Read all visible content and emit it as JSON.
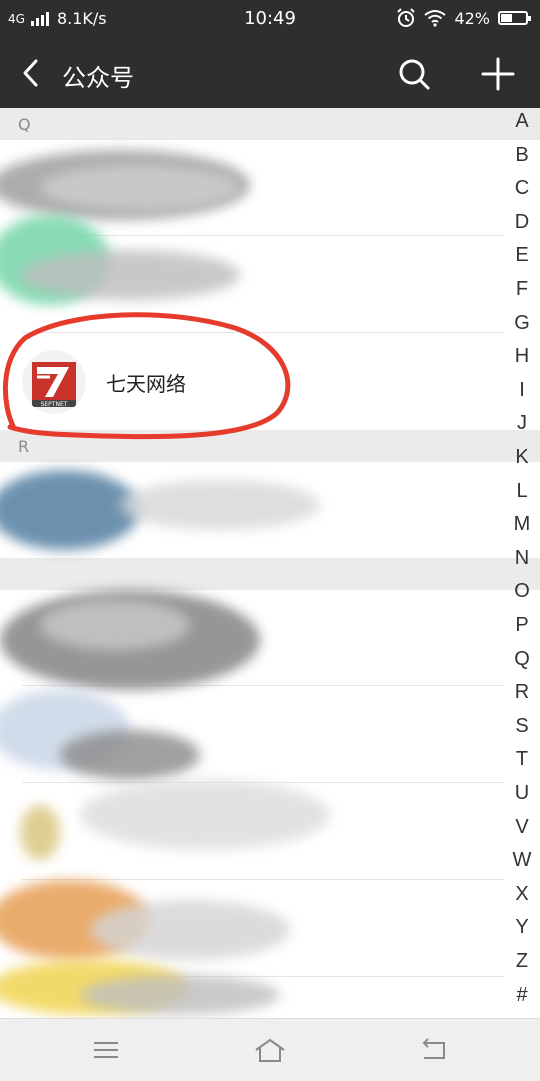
{
  "status_bar": {
    "network": "4G",
    "speed": "8.1K/s",
    "time": "10:49",
    "battery": "42%"
  },
  "header": {
    "title": "公众号"
  },
  "sections": [
    {
      "letter": "Q",
      "item_names": [
        "",
        "",
        "七天网络"
      ]
    },
    {
      "letter": "R",
      "item_names": [
        "",
        "",
        "",
        "",
        "",
        ""
      ]
    }
  ],
  "highlight_item": {
    "name": "七天网络",
    "logo_text": "SEPTNET"
  },
  "index_letters": [
    "A",
    "B",
    "C",
    "D",
    "E",
    "F",
    "G",
    "H",
    "I",
    "J",
    "K",
    "L",
    "M",
    "N",
    "O",
    "P",
    "Q",
    "R",
    "S",
    "T",
    "U",
    "V",
    "W",
    "X",
    "Y",
    "Z",
    "#"
  ],
  "colors": {
    "bar_bg": "#2e2e2e",
    "section_bg": "#ebebeb",
    "logo_red": "#c8342b",
    "annotation_red": "#e53b2c"
  },
  "icons": {
    "back": "chevron-left-icon",
    "search": "search-icon",
    "add": "plus-icon",
    "menu": "menu-icon",
    "home": "home-icon",
    "return": "return-icon"
  }
}
